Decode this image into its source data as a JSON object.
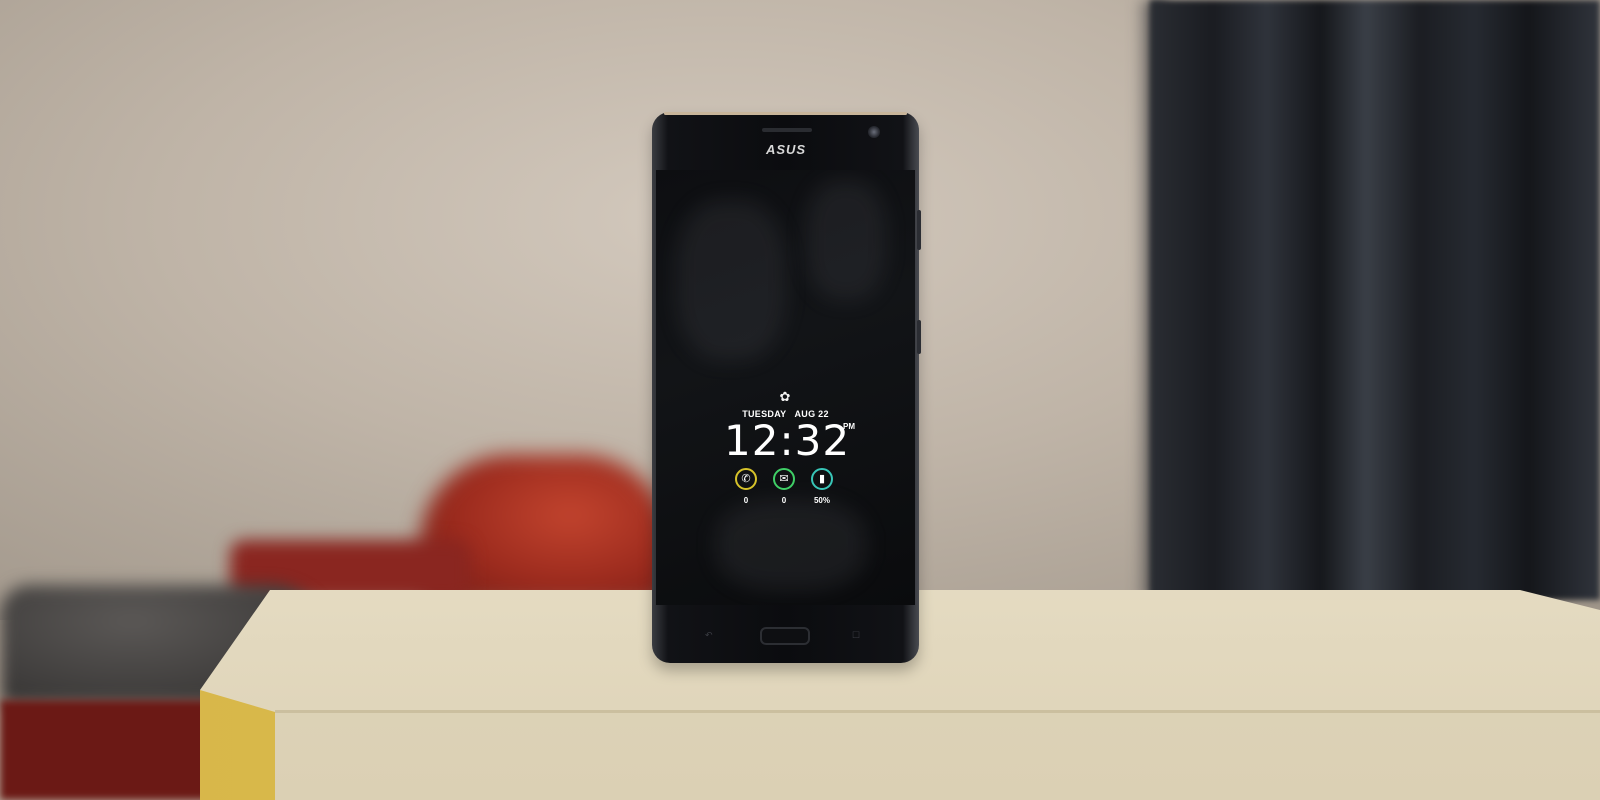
{
  "scene": {
    "device": {
      "brand": "ASUS"
    },
    "lock_screen": {
      "day": "TUESDAY",
      "date": "AUG 22",
      "time": "12:32",
      "ampm": "PM",
      "notifications": [
        {
          "icon": "phone-icon",
          "count": "0",
          "color": "#d6c22a"
        },
        {
          "icon": "message-icon",
          "count": "0",
          "color": "#3fcf66"
        },
        {
          "icon": "battery-icon",
          "count": "50%",
          "color": "#38c6b8"
        }
      ]
    }
  }
}
